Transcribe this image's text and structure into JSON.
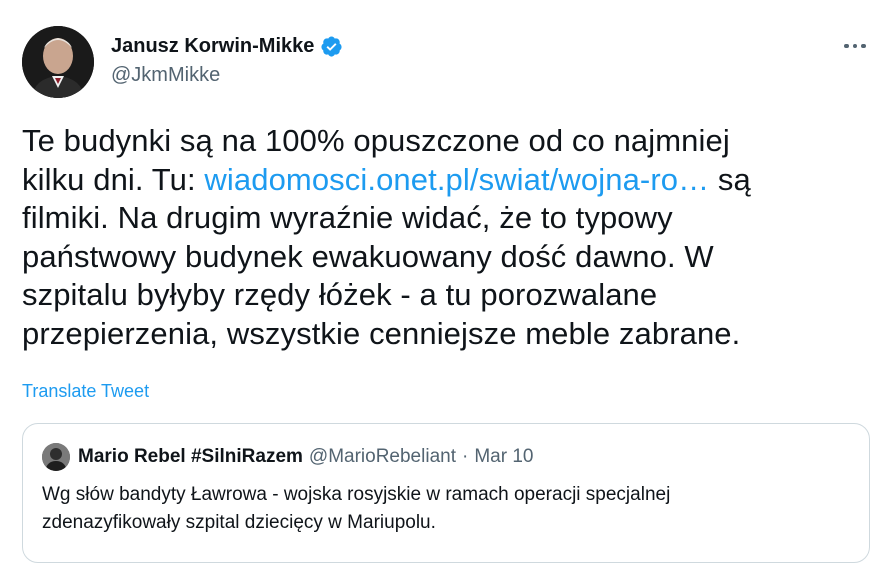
{
  "author": {
    "display_name": "Janusz Korwin-Mikke",
    "handle": "@JkmMikke",
    "verified": true,
    "verified_icon": "verified-badge-icon"
  },
  "more_icon": "more-horizontal-icon",
  "tweet": {
    "line1": "Te budynki są na 100% opuszczone od co najmniej",
    "line2_before": "kilku dni. Tu: ",
    "link_text": "wiadomosci.onet.pl/swiat/wojna-ro…",
    "line2_after": " są",
    "line3": "filmiki. Na drugim wyraźnie widać, że to typowy",
    "line4": "państwowy budynek ewakuowany dość dawno. W",
    "line5": "szpitalu byłyby rzędy łóżek - a tu porozwalane",
    "line6": "przepierzenia, wszystkie cenniejsze meble zabrane."
  },
  "translate_label": "Translate Tweet",
  "quoted": {
    "display_name": "Mario Rebel #SilniRazem",
    "handle": "@MarioRebeliant",
    "separator": "·",
    "date": "Mar 10",
    "line1": "Wg słów bandyty Ławrowa - wojska rosyjskie w ramach operacji specjalnej",
    "line2": "zdenazyfikowały szpital dziecięcy w Mariupolu."
  },
  "colors": {
    "link": "#1d9bf0",
    "text": "#0f1419",
    "secondary": "#536471",
    "border": "#cfd9de"
  }
}
